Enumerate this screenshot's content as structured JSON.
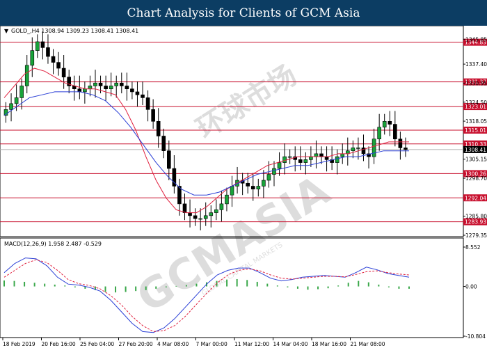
{
  "banner": {
    "title": "Chart Analysis for Clients of GCM Asia"
  },
  "chart_data": [
    {
      "type": "candlestick",
      "header": "GOLD_,H4  1308.94 1309.23 1308.41 1308.41",
      "last_price": 1308.41,
      "ylim": [
        1279.35,
        1349.0
      ],
      "y_ticks": [
        1345.85,
        1337.4,
        1330.95,
        1324.5,
        1318.05,
        1305.15,
        1298.7,
        1285.8,
        1279.35
      ],
      "x_tick_labels": [
        "18 Feb 2019",
        "20 Feb 16:00",
        "25 Feb 04:00",
        "27 Feb 20:00",
        "4 Mar 08:00",
        "7 Mar 00:00",
        "11 Mar 12:00",
        "14 Mar 04:00",
        "18 Mar 16:00",
        "21 Mar 08:00"
      ],
      "levels": [
        {
          "value": 1344.83,
          "label": "1344.83"
        },
        {
          "value": 1331.37,
          "label": "1331.37"
        },
        {
          "value": 1323.01,
          "label": "1323.01"
        },
        {
          "value": 1315.01,
          "label": "1315.01"
        },
        {
          "value": 1310.33,
          "label": "1310.33"
        },
        {
          "value": 1300.26,
          "label": "1300.26"
        },
        {
          "value": 1292.04,
          "label": "1292.04"
        },
        {
          "value": 1283.93,
          "label": "1283.93"
        }
      ],
      "closes": [
        1322,
        1324,
        1326,
        1330,
        1337,
        1342,
        1345,
        1343,
        1340,
        1338,
        1336,
        1333,
        1330,
        1329,
        1328,
        1329,
        1330,
        1331,
        1330,
        1329,
        1330,
        1331,
        1330,
        1329,
        1328,
        1327,
        1326,
        1322,
        1318,
        1313,
        1308,
        1302,
        1296,
        1290,
        1287,
        1286,
        1285,
        1285,
        1286,
        1287,
        1288,
        1290,
        1293,
        1296,
        1298,
        1297,
        1296,
        1295,
        1296,
        1298,
        1300,
        1302,
        1304,
        1306,
        1306,
        1305,
        1304,
        1305,
        1306,
        1307,
        1306,
        1305,
        1304,
        1306,
        1307,
        1308,
        1309,
        1309,
        1307,
        1306,
        1312,
        1316,
        1318,
        1317,
        1312,
        1309,
        1308.41
      ],
      "series": [
        {
          "name": "red moving average",
          "color": "#e0213f"
        },
        {
          "name": "blue moving average",
          "color": "#2a3fd6"
        }
      ],
      "ma_fast": [
        1326,
        1330,
        1334,
        1336,
        1335,
        1333,
        1331,
        1330,
        1329,
        1329,
        1328,
        1327,
        1322,
        1315,
        1306,
        1298,
        1292,
        1288,
        1287,
        1287,
        1289,
        1292,
        1295,
        1297,
        1299,
        1301,
        1303,
        1304,
        1305,
        1306,
        1306,
        1306,
        1306,
        1307,
        1307,
        1308,
        1309,
        1310,
        1311,
        1311,
        1311
      ],
      "ma_slow": [
        1320,
        1323,
        1326,
        1327,
        1328,
        1328,
        1328,
        1327,
        1325,
        1321,
        1316,
        1310,
        1304,
        1299,
        1295,
        1293,
        1293,
        1294,
        1296,
        1298,
        1300,
        1301,
        1302,
        1303,
        1303,
        1304,
        1305,
        1306,
        1306,
        1307,
        1308,
        1308,
        1308
      ]
    },
    {
      "type": "macd",
      "title": "MACD(12,26,9) 1.958 2.487 -0.529",
      "ylim": [
        -10.804,
        8.552
      ],
      "y_ticks": [
        8.552,
        0.0,
        -10.804
      ],
      "histogram": [
        1.3,
        1.2,
        1.0,
        0.8,
        0.6,
        0.4,
        0.2,
        -0.2,
        -0.5,
        -0.8,
        -1.2,
        -1.3,
        -1.2,
        -1.0,
        -0.8,
        -0.5,
        -0.2,
        0.1,
        0.3,
        0.6,
        0.9,
        1.2,
        1.5,
        1.6,
        1.4,
        1.0,
        0.6,
        0.2,
        -0.2,
        -0.5,
        -0.7,
        -0.6,
        -0.4,
        0.2,
        0.8,
        1.2,
        0.9,
        0.4,
        -0.2,
        -0.5,
        -0.5
      ],
      "series": [
        {
          "name": "macd line",
          "color": "#2a3fd6",
          "values": [
            3.0,
            5.0,
            6.2,
            6.0,
            4.5,
            2.0,
            0.5,
            0.3,
            -0.2,
            -1.0,
            -3.0,
            -5.5,
            -8.0,
            -9.8,
            -10.0,
            -9.0,
            -7.0,
            -4.5,
            -2.0,
            0.5,
            2.5,
            3.5,
            4.0,
            4.0,
            3.0,
            1.8,
            1.2,
            1.5,
            2.0,
            2.2,
            2.4,
            2.2,
            2.0,
            3.0,
            4.2,
            3.6,
            2.8,
            2.4,
            2.0
          ]
        },
        {
          "name": "signal line",
          "color": "#e0213f",
          "values": [
            2.0,
            3.5,
            5.0,
            5.8,
            5.2,
            3.5,
            1.5,
            0.6,
            0.2,
            -0.5,
            -2.0,
            -4.0,
            -6.5,
            -8.5,
            -9.8,
            -9.6,
            -8.5,
            -6.5,
            -4.0,
            -1.5,
            0.8,
            2.5,
            3.5,
            3.8,
            3.4,
            2.5,
            1.8,
            1.6,
            1.8,
            2.0,
            2.2,
            2.2,
            2.1,
            2.6,
            3.2,
            3.4,
            3.0,
            2.7,
            2.5
          ]
        }
      ]
    }
  ],
  "watermark": {
    "brand": "GCMASIA",
    "sub": "GLOBAL CAPITAL MARKETS",
    "cn": "环球市场"
  }
}
